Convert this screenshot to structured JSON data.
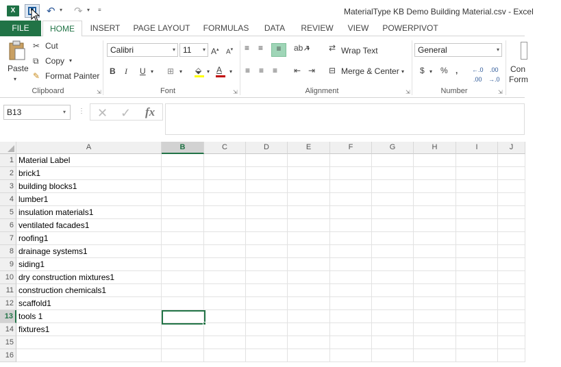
{
  "app": {
    "logo_text": "X",
    "window_title": "MaterialType KB Demo Building Material.csv - Excel"
  },
  "qat": {
    "save_icon": "save-icon",
    "undo_icon": "undo-icon",
    "redo_icon": "redo-icon"
  },
  "tabs": [
    "FILE",
    "HOME",
    "INSERT",
    "PAGE LAYOUT",
    "FORMULAS",
    "DATA",
    "REVIEW",
    "VIEW",
    "POWERPIVOT"
  ],
  "ribbon": {
    "clipboard": {
      "paste": "Paste",
      "cut": "Cut",
      "copy": "Copy",
      "format_painter": "Format Painter",
      "label": "Clipboard"
    },
    "font": {
      "name": "Calibri",
      "size": "11",
      "bold": "B",
      "italic": "I",
      "underline": "U",
      "label": "Font"
    },
    "alignment": {
      "wrap_text": "Wrap Text",
      "merge_center": "Merge & Center",
      "label": "Alignment"
    },
    "number": {
      "format": "General",
      "currency": "$",
      "percent": "%",
      "comma": ",",
      "label": "Number"
    },
    "styles": {
      "conditional": "Con",
      "format": "Form"
    }
  },
  "formula_bar": {
    "name_box": "B13",
    "fx": "fx",
    "cancel": "✕",
    "enter": "✓",
    "value": ""
  },
  "columns": [
    "A",
    "B",
    "C",
    "D",
    "E",
    "F",
    "G",
    "H",
    "I",
    "J"
  ],
  "selected": {
    "column": "B",
    "row": 13
  },
  "rows": [
    {
      "n": "1",
      "a": "Material Label"
    },
    {
      "n": "2",
      "a": "brick1"
    },
    {
      "n": "3",
      "a": "building blocks1"
    },
    {
      "n": "4",
      "a": "lumber1"
    },
    {
      "n": "5",
      "a": "insulation materials1"
    },
    {
      "n": "6",
      "a": "ventilated facades1"
    },
    {
      "n": "7",
      "a": "roofing1"
    },
    {
      "n": "8",
      "a": "drainage systems1"
    },
    {
      "n": "9",
      "a": "siding1"
    },
    {
      "n": "10",
      "a": "dry construction mixtures1"
    },
    {
      "n": "11",
      "a": "construction chemicals1"
    },
    {
      "n": "12",
      "a": "scaffold1"
    },
    {
      "n": "13",
      "a": "tools  1"
    },
    {
      "n": "14",
      "a": "fixtures1"
    },
    {
      "n": "15",
      "a": ""
    },
    {
      "n": "16",
      "a": ""
    }
  ],
  "colors": {
    "accent": "#217346",
    "selected_header": "#d2d2d2"
  }
}
